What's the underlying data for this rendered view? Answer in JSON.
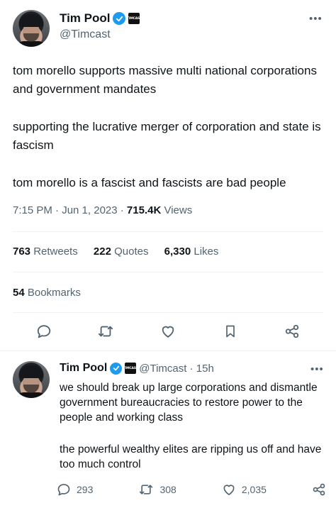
{
  "main_tweet": {
    "display_name": "Tim Pool",
    "affiliate_badge": "TIMCAST",
    "handle": "@Timcast",
    "paragraphs": [
      "tom morello supports massive multi national corporations and government mandates",
      "supporting the lucrative merger of corporation and state is fascism",
      "tom morello is a fascist and fascists are bad people"
    ],
    "time": "7:15 PM · Jun 1, 2023 · ",
    "views_count": "715.4K",
    "views_label": " Views",
    "stats": {
      "retweets_count": "763",
      "retweets_label": " Retweets",
      "quotes_count": "222",
      "quotes_label": " Quotes",
      "likes_count": "6,330",
      "likes_label": " Likes",
      "bookmarks_count": "54",
      "bookmarks_label": " Bookmarks"
    },
    "actions": [
      "reply-icon",
      "retweet-icon",
      "like-icon",
      "bookmark-icon",
      "share-icon"
    ]
  },
  "reply_tweet": {
    "display_name": "Tim Pool",
    "affiliate_badge": "TIMCAST",
    "handle_time": "@Timcast · 15h",
    "paragraphs": [
      "we should break up large corporations and dismantle government bureaucracies  to restore power to the people and working class",
      "the powerful wealthy elites are ripping us off and have too much control"
    ],
    "replies": "293",
    "retweets": "308",
    "likes": "2,035"
  },
  "colors": {
    "text": "#0f1419",
    "secondary": "#536471",
    "verified": "#1d9bf0",
    "divider": "#eff3f4"
  }
}
